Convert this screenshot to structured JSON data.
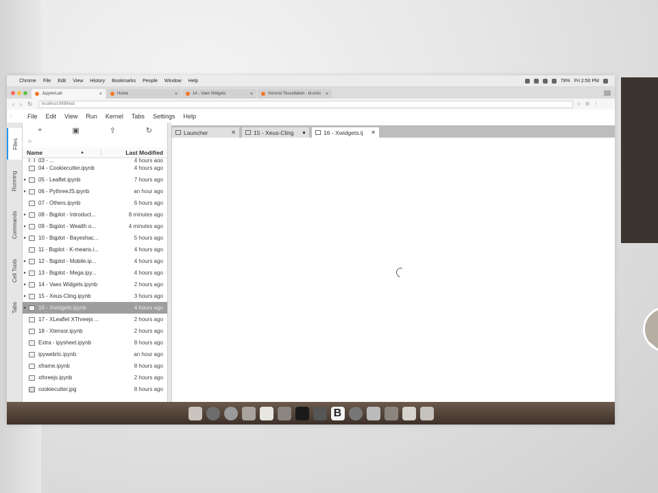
{
  "mac_menu": {
    "apple": "",
    "items": [
      "Chrome",
      "File",
      "Edit",
      "View",
      "History",
      "Bookmarks",
      "People",
      "Window",
      "Help"
    ],
    "battery": "78%",
    "clock": "Fri 2:50 PM"
  },
  "browser": {
    "tabs": [
      {
        "label": "JupyterLab",
        "active": true
      },
      {
        "label": "Home",
        "active": false
      },
      {
        "label": "14 - Vaex Widgets",
        "active": false
      },
      {
        "label": "Voronoi Tessellation - bl.ocks",
        "active": false
      }
    ],
    "url": "localhost:8888/lab"
  },
  "jupyter_menu": [
    "File",
    "Edit",
    "View",
    "Run",
    "Kernel",
    "Tabs",
    "Settings",
    "Help"
  ],
  "sidebar_tabs": [
    "Files",
    "Running",
    "Commands",
    "Cell Tools",
    "Tabs"
  ],
  "file_browser": {
    "toolbar": {
      "new": "+",
      "new_folder": "▣",
      "upload": "⇪",
      "refresh": "↻"
    },
    "breadcrumb_icon": "home-icon",
    "header": {
      "name": "Name",
      "sort": "▲",
      "last_modified": "Last Modified"
    },
    "files": [
      {
        "name": "03 - ...",
        "modified": "4 hours ago",
        "running": false,
        "kind": "notebook",
        "partial": true
      },
      {
        "name": "04 - Cookiecutter.ipynb",
        "modified": "4 hours ago",
        "running": false,
        "kind": "notebook"
      },
      {
        "name": "05 - Leaflet.ipynb",
        "modified": "7 hours ago",
        "running": true,
        "kind": "notebook"
      },
      {
        "name": "06 - PythreeJS.ipynb",
        "modified": "an hour ago",
        "running": true,
        "kind": "notebook"
      },
      {
        "name": "07 - Others.ipynb",
        "modified": "6 hours ago",
        "running": false,
        "kind": "notebook"
      },
      {
        "name": "08 - Bqplot - Introduct...",
        "modified": "8 minutes ago",
        "running": true,
        "kind": "notebook"
      },
      {
        "name": "09 - Bqplot - Wealth o...",
        "modified": "4 minutes ago",
        "running": true,
        "kind": "notebook"
      },
      {
        "name": "10 - Bqplot - Bayeshac...",
        "modified": "5 hours ago",
        "running": true,
        "kind": "notebook"
      },
      {
        "name": "11 - Bqplot - K-means.i...",
        "modified": "4 hours ago",
        "running": false,
        "kind": "notebook"
      },
      {
        "name": "12 - Bqplot - Mobile.ip...",
        "modified": "4 hours ago",
        "running": true,
        "kind": "notebook"
      },
      {
        "name": "13 - Bqplot - Mega.ipy...",
        "modified": "4 hours ago",
        "running": true,
        "kind": "notebook"
      },
      {
        "name": "14 - Vaex Widgets.ipynb",
        "modified": "2 hours ago",
        "running": true,
        "kind": "notebook"
      },
      {
        "name": "15 - Xeus-Cling.ipynb",
        "modified": "3 hours ago",
        "running": true,
        "kind": "notebook"
      },
      {
        "name": "16 - Xwidgets.ipynb",
        "modified": "4 hours ago",
        "running": true,
        "kind": "notebook",
        "selected": true
      },
      {
        "name": "17 - XLeaflet XThreejs ...",
        "modified": "2 hours ago",
        "running": false,
        "kind": "notebook"
      },
      {
        "name": "18 - Xtensor.ipynb",
        "modified": "2 hours ago",
        "running": false,
        "kind": "notebook"
      },
      {
        "name": "Extra - ipysheet.ipynb",
        "modified": "8 hours ago",
        "running": false,
        "kind": "notebook"
      },
      {
        "name": "ipywebrtc.ipynb",
        "modified": "an hour ago",
        "running": false,
        "kind": "notebook"
      },
      {
        "name": "xframe.ipynb",
        "modified": "8 hours ago",
        "running": false,
        "kind": "notebook"
      },
      {
        "name": "xthreejs.ipynb",
        "modified": "2 hours ago",
        "running": false,
        "kind": "notebook"
      },
      {
        "name": "cookiecutter.jpg",
        "modified": "8 hours ago",
        "running": false,
        "kind": "image"
      }
    ]
  },
  "main_tabs": [
    {
      "label": "Launcher",
      "active": false,
      "close": "✕"
    },
    {
      "label": "15 - Xeus-Cling",
      "active": false,
      "close": "●"
    },
    {
      "label": "16 - Xwidgets.ij",
      "active": true,
      "close": "✕"
    }
  ],
  "colors": {
    "accent": "#2196f3",
    "selected_row": "#9e9e9e",
    "tab_strip": "#bdbdbd"
  }
}
